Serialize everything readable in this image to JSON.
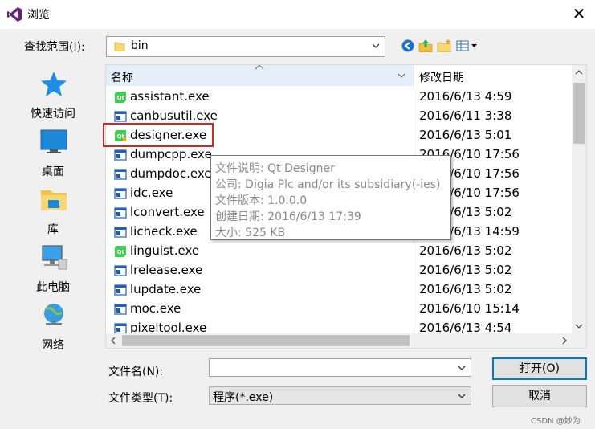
{
  "window": {
    "title": "浏览",
    "close_glyph": "✕"
  },
  "lookin": {
    "label": "查找范围(I):",
    "value": "bin"
  },
  "places": [
    {
      "label": "快速访问",
      "icon": "star-icon"
    },
    {
      "label": "桌面",
      "icon": "desktop-icon"
    },
    {
      "label": "库",
      "icon": "library-icon"
    },
    {
      "label": "此电脑",
      "icon": "computer-icon"
    },
    {
      "label": "网络",
      "icon": "network-icon"
    }
  ],
  "columns": {
    "name": "名称",
    "date": "修改日期"
  },
  "files": [
    {
      "name": "assistant.exe",
      "date": "2016/6/13 4:59",
      "icon": "qt-icon"
    },
    {
      "name": "canbusutil.exe",
      "date": "2016/6/11 3:38",
      "icon": "exe-icon"
    },
    {
      "name": "designer.exe",
      "date": "2016/6/13 5:01",
      "icon": "qt-designer-icon"
    },
    {
      "name": "dumpcpp.exe",
      "date": "2016/6/10 17:56",
      "icon": "exe-icon"
    },
    {
      "name": "dumpdoc.exe",
      "date": "2016/6/10 17:56",
      "icon": "exe-icon"
    },
    {
      "name": "idc.exe",
      "date": "2016/6/10 17:56",
      "icon": "exe-icon"
    },
    {
      "name": "lconvert.exe",
      "date": "2016/6/13 5:02",
      "icon": "exe-icon"
    },
    {
      "name": "licheck.exe",
      "date": "2016/6/13 14:59",
      "icon": "exe-icon"
    },
    {
      "name": "linguist.exe",
      "date": "2016/6/13 5:02",
      "icon": "qt-icon"
    },
    {
      "name": "lrelease.exe",
      "date": "2016/6/13 5:02",
      "icon": "exe-icon"
    },
    {
      "name": "lupdate.exe",
      "date": "2016/6/13 5:02",
      "icon": "exe-icon"
    },
    {
      "name": "moc.exe",
      "date": "2016/6/10 15:14",
      "icon": "exe-icon"
    },
    {
      "name": "pixeltool.exe",
      "date": "2016/6/13 4:54",
      "icon": "exe-icon"
    }
  ],
  "tooltip": {
    "description": "文件说明: Qt Designer",
    "company": "公司: Digia Plc and/or its subsidiary(-ies)",
    "version": "文件版本: 1.0.0.0",
    "created": "创建日期: 2016/6/13 17:39",
    "size": "大小: 525 KB"
  },
  "filename": {
    "label": "文件名(N):",
    "value": ""
  },
  "filetype": {
    "label": "文件类型(T):",
    "value": "程序(*.exe)"
  },
  "buttons": {
    "open": "打开(O)",
    "cancel": "取消"
  },
  "watermark": "CSDN @妙为",
  "colors": {
    "accent": "#0078d7",
    "highlight_border": "#e02020",
    "qt_green": "#41cd52"
  }
}
